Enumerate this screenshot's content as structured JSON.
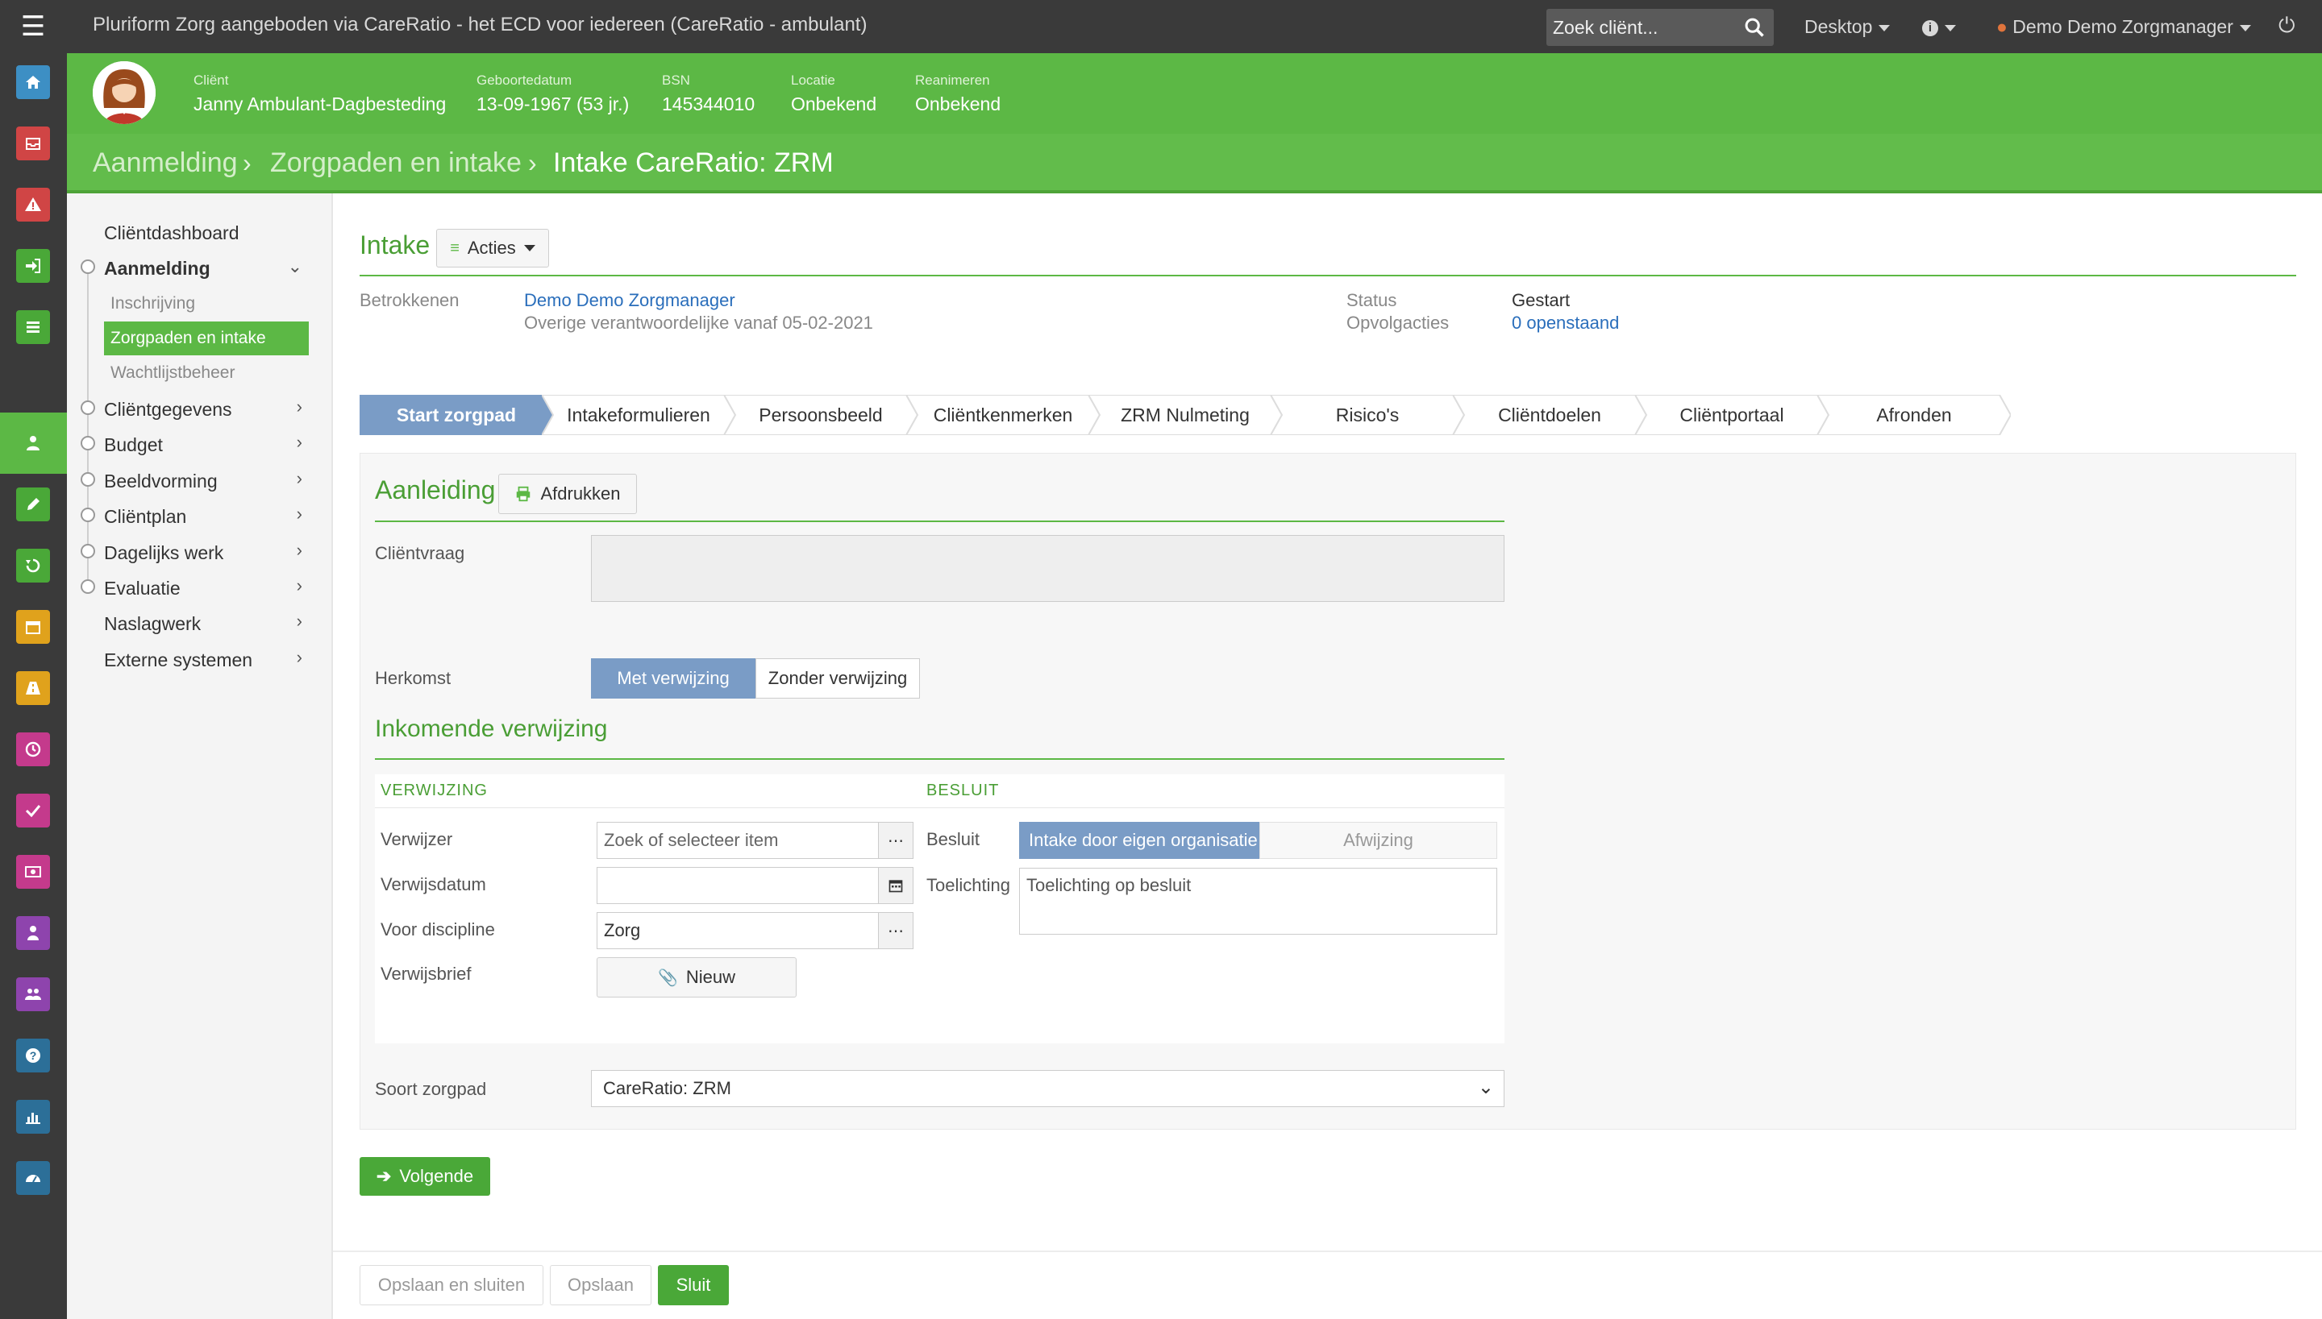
{
  "topbar": {
    "title": "Pluriform Zorg aangeboden via CareRatio - het ECD voor iedereen  (CareRatio - ambulant)",
    "search_placeholder": "Zoek cliënt...",
    "desktop": "Desktop",
    "user": "Demo Demo Zorgmanager"
  },
  "client": {
    "client_label": "Cliënt",
    "client_name": "Janny Ambulant-Dagbesteding",
    "dob_label": "Geboortedatum",
    "dob": "13-09-1967 (53 jr.)",
    "bsn_label": "BSN",
    "bsn": "145344010",
    "location_label": "Locatie",
    "location": "Onbekend",
    "resus_label": "Reanimeren",
    "resus": "Onbekend"
  },
  "breadcrumb": [
    "Aanmelding",
    "Zorgpaden en intake",
    "Intake CareRatio: ZRM"
  ],
  "leftmenu": {
    "dashboard": "Cliëntdashboard",
    "aanmelding": "Aanmelding",
    "inschrijving": "Inschrijving",
    "zorgpaden": "Zorgpaden en intake",
    "wachtlijst": "Wachtlijstbeheer",
    "clientgegevens": "Cliëntgegevens",
    "budget": "Budget",
    "beeldvorming": "Beeldvorming",
    "clientplan": "Cliëntplan",
    "dagelijks": "Dagelijks werk",
    "evaluatie": "Evaluatie",
    "naslagwerk": "Naslagwerk",
    "extern": "Externe systemen"
  },
  "intake": {
    "title": "Intake",
    "acties": "Acties",
    "betrokkenen_label": "Betrokkenen",
    "betrokkene": "Demo Demo Zorgmanager",
    "betrokkene_sub": "Overige verantwoordelijke vanaf 05-02-2021",
    "status_label": "Status",
    "status": "Gestart",
    "opvolg_label": "Opvolgacties",
    "opvolg": "0 openstaand"
  },
  "wizard": [
    "Start zorgpad",
    "Intakeformulieren",
    "Persoonsbeeld",
    "Cliëntkenmerken",
    "ZRM Nulmeting",
    "Risico's",
    "Cliëntdoelen",
    "Cliëntportaal",
    "Afronden"
  ],
  "aanleiding": {
    "title": "Aanleiding",
    "print": "Afdrukken",
    "clientvraag_label": "Cliëntvraag",
    "herkomst_label": "Herkomst",
    "herkomst_options": [
      "Met verwijzing",
      "Zonder verwijzing"
    ],
    "inkomende_title": "Inkomende verwijzing",
    "verwijzing_head": "VERWIJZING",
    "besluit_head": "BESLUIT",
    "verwijzer_label": "Verwijzer",
    "verwijzer_placeholder": "Zoek of selecteer item",
    "verwijsdatum_label": "Verwijsdatum",
    "discipline_label": "Voor discipline",
    "discipline_value": "Zorg",
    "verwijsbrief_label": "Verwijsbrief",
    "nieuw": "Nieuw",
    "besluit_label": "Besluit",
    "besluit_options": [
      "Intake door eigen organisatie",
      "Afwijzing"
    ],
    "toelichting_label": "Toelichting",
    "toelichting_placeholder": "Toelichting op besluit",
    "soort_label": "Soort zorgpad",
    "soort_value": "CareRatio: ZRM"
  },
  "buttons": {
    "volgende": "Volgende",
    "opslaan_sluiten": "Opslaan en sluiten",
    "opslaan": "Opslaan",
    "sluit": "Sluit"
  },
  "colors": {
    "green": "#5cb845",
    "darkbar": "#3a3a3a",
    "steel": "#7a9cc6"
  }
}
